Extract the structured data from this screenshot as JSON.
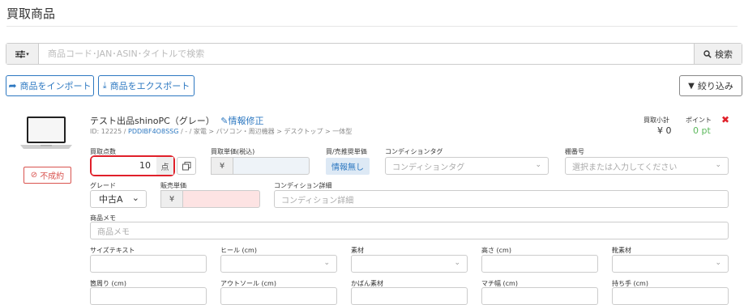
{
  "page": {
    "title": "買取商品"
  },
  "search": {
    "placeholder": "商品コード･JAN･ASIN･タイトルで検索",
    "button_label": "検索",
    "filter_icon": "sliders-icon"
  },
  "toolbar": {
    "import_label": "商品をインポート",
    "export_label": "商品をエクスポート",
    "filter_label": "絞り込み"
  },
  "product": {
    "name": "テスト出品shinoPC（グレー）",
    "edit_label": "情報修正",
    "id_text": "ID: 12225 /",
    "code": "PDDIBF4O8SSG",
    "category_path": "/ - / 家電 > パソコン・周辺機器 > デスクトップ > 一体型",
    "status": "不成約",
    "subtotal_label": "買取小計",
    "subtotal_value": "¥ 0",
    "points_label": "ポイント",
    "points_value": "0 pt"
  },
  "form": {
    "qty_label": "買取点数",
    "qty_value": "10",
    "qty_unit": "点",
    "unit_price_label": "買取単価(税込)",
    "currency": "¥",
    "suggested_label": "買/売推奨単価",
    "suggested_value": "情報無し",
    "condition_tag_label": "コンディションタグ",
    "condition_tag_placeholder": "コンディションタグ",
    "shelf_label": "棚番号",
    "shelf_placeholder": "選択または入力してください",
    "grade_label": "グレード",
    "grade_value": "中古A",
    "sale_price_label": "販売単価",
    "condition_detail_label": "コンディション詳細",
    "condition_detail_placeholder": "コンディション詳細",
    "memo_label": "商品メモ",
    "memo_placeholder": "商品メモ",
    "size_text_label": "サイズテキスト",
    "heel_label": "ヒール (cm)",
    "material_label": "素材",
    "height_label": "高さ (cm)",
    "shoe_material_label": "靴素材",
    "waist_label": "箇周り (cm)",
    "outsole_label": "アウトソール (cm)",
    "bag_material_label": "かばん素材",
    "gusset_label": "マチ幅 (cm)",
    "handle_label": "持ち手 (cm)"
  },
  "colors": {
    "accent": "#2d78c1",
    "danger": "#e0202a",
    "success": "#5cb85c"
  }
}
